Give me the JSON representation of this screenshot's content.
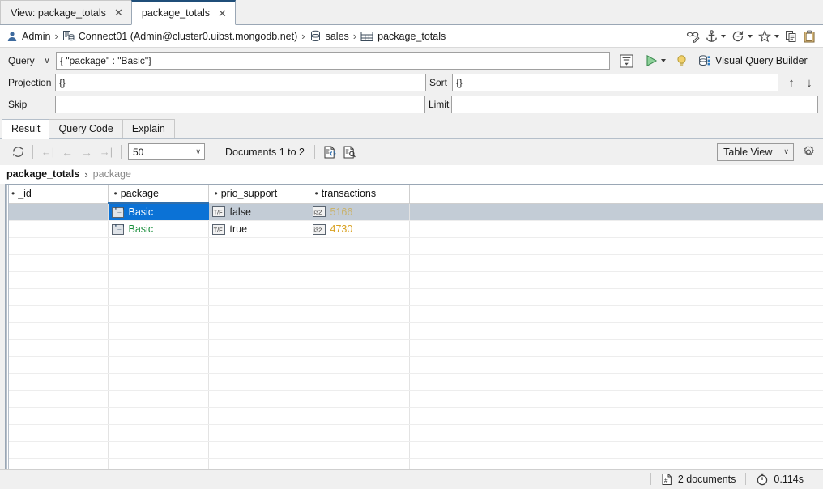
{
  "window": {
    "tabs": [
      {
        "label": "View: package_totals",
        "active": false,
        "close": "✕"
      },
      {
        "label": "package_totals",
        "active": true,
        "close": "✕"
      }
    ]
  },
  "breadcrumb": {
    "user": "Admin",
    "sep": "›",
    "connection": "Connect01 (Admin@cluster0.uibst.mongodb.net)",
    "database": "sales",
    "collection": "package_totals",
    "icons": {
      "user": "user-icon",
      "connection": "server-icon",
      "database": "database-icon",
      "collection": "collection-icon"
    },
    "tools": [
      {
        "name": "glasses-edit-icon",
        "has_caret": false
      },
      {
        "name": "anchor-icon",
        "has_caret": true
      },
      {
        "name": "history-icon",
        "has_caret": true
      },
      {
        "name": "favorite-star-icon",
        "has_caret": true
      },
      {
        "name": "copy-icon",
        "has_caret": false
      },
      {
        "name": "paste-icon",
        "has_caret": false
      }
    ]
  },
  "query": {
    "label": "Query",
    "chevron": "∨",
    "value": "{ \"package\" : \"Basic\"}",
    "placeholder": "",
    "format_button": "format-query-button",
    "run_button": "run-query-button",
    "run_caret": "run-options-caret",
    "hint_button": "explain-hint-button",
    "visual_builder_label": "Visual Query Builder",
    "projection": {
      "label": "Projection",
      "value": "{}"
    },
    "sort": {
      "label": "Sort",
      "value": "{}"
    },
    "skip": {
      "label": "Skip",
      "value": ""
    },
    "limit": {
      "label": "Limit",
      "value": ""
    },
    "move_up": "↑",
    "move_down": "↓"
  },
  "result": {
    "tabs": [
      {
        "label": "Result",
        "active": true
      },
      {
        "label": "Query Code",
        "active": false
      },
      {
        "label": "Explain",
        "active": false
      }
    ],
    "toolbar": {
      "refresh": "refresh-icon",
      "first": "←|",
      "prev": "←",
      "next": "→",
      "last": "→|",
      "page_size": "50",
      "page_size_caret": "∨",
      "documents_range": "Documents 1 to 2",
      "view_json_icon": "document-code-icon",
      "view_find_icon": "document-search-icon",
      "view_mode": "Table View",
      "view_mode_caret": "∨",
      "settings_icon": "gear-icon"
    },
    "path": {
      "root": "package_totals",
      "sep": "›",
      "field": "package"
    },
    "table": {
      "columns": [
        {
          "name": "_id",
          "sorted": false
        },
        {
          "name": "package",
          "sorted": true
        },
        {
          "name": "prio_support",
          "sorted": false
        },
        {
          "name": "transactions",
          "sorted": false
        }
      ],
      "rows": [
        {
          "selected": true,
          "cells": [
            {
              "type": "",
              "value": "",
              "focused": false
            },
            {
              "type": "string",
              "value": "Basic",
              "focused": true
            },
            {
              "type": "bool",
              "value": "false",
              "focused": false
            },
            {
              "type": "int32",
              "value": "5166",
              "focused": false
            }
          ]
        },
        {
          "selected": false,
          "cells": [
            {
              "type": "",
              "value": "",
              "focused": false
            },
            {
              "type": "string",
              "value": "Basic",
              "focused": false
            },
            {
              "type": "bool",
              "value": "true",
              "focused": false
            },
            {
              "type": "int32",
              "value": "4730",
              "focused": false
            }
          ]
        }
      ],
      "empty_row_count": 14
    }
  },
  "status": {
    "documents_icon": "document-count-icon",
    "documents": "2 documents",
    "timer_icon": "stopwatch-icon",
    "duration": "0.114s"
  },
  "colors": {
    "accent": "#0b72d6",
    "selection": "#c3ccd6",
    "string": "#1a8f3c",
    "number": "#d8a020",
    "tab_active_top": "#1f4e79"
  }
}
